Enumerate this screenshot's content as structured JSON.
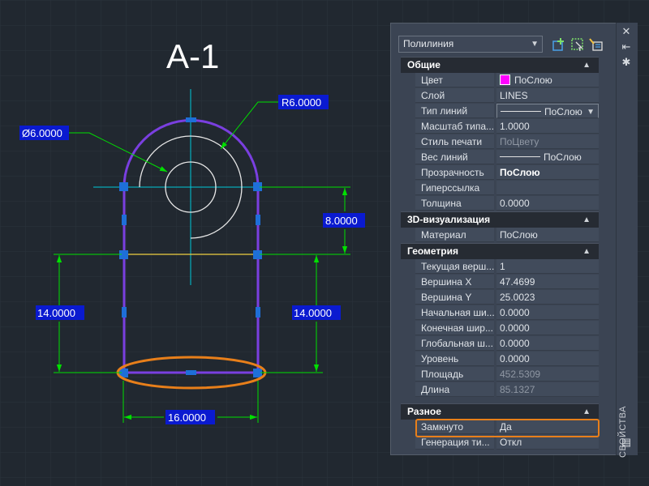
{
  "drawing": {
    "title": "A-1",
    "dims": {
      "radius": "R6.0000",
      "diameter": "Ø6.0000",
      "vertical_small": "8.0000",
      "left_height": "14.0000",
      "right_height": "14.0000",
      "bottom_width": "16.0000"
    },
    "colors": {
      "background": "#212830",
      "grid": "#2b333d",
      "polyline": "#7a3fe0",
      "dimension": "#00e000",
      "centerline": "#00c8d8",
      "circle": "#e8e8e8",
      "horizontal_line": "#f0d040",
      "grip": "#1e6fd8",
      "highlight": "#e87f1a"
    }
  },
  "palette": {
    "object_type": "Полилиния",
    "strip_title": "СВОЙСТВА",
    "categories": {
      "general": "Общие",
      "viz3d": "3D-визуализация",
      "geometry": "Геометрия",
      "misc": "Разное"
    },
    "general": [
      {
        "name": "Цвет",
        "value": "ПоСлою"
      },
      {
        "name": "Слой",
        "value": "LINES"
      },
      {
        "name": "Тип линий",
        "value": "ПоСлою"
      },
      {
        "name": "Масштаб типа...",
        "value": "1.0000"
      },
      {
        "name": "Стиль печати",
        "value": "ПоЦвету"
      },
      {
        "name": "Вес линий",
        "value": "ПоСлою"
      },
      {
        "name": "Прозрачность",
        "value": "ПоСлою"
      },
      {
        "name": "Гиперссылка",
        "value": ""
      },
      {
        "name": "Толщина",
        "value": "0.0000"
      }
    ],
    "viz3d": [
      {
        "name": "Материал",
        "value": "ПоСлою"
      }
    ],
    "geometry": [
      {
        "name": "Текущая верш...",
        "value": "1"
      },
      {
        "name": "Вершина X",
        "value": "47.4699"
      },
      {
        "name": "Вершина Y",
        "value": "25.0023"
      },
      {
        "name": "Начальная ши...",
        "value": "0.0000"
      },
      {
        "name": "Конечная шир...",
        "value": "0.0000"
      },
      {
        "name": "Глобальная ш...",
        "value": "0.0000"
      },
      {
        "name": "Уровень",
        "value": "0.0000"
      },
      {
        "name": "Площадь",
        "value": "452.5309"
      },
      {
        "name": "Длина",
        "value": "85.1327"
      }
    ],
    "misc": [
      {
        "name": "Замкнуто",
        "value": "Да"
      },
      {
        "name": "Генерация ти...",
        "value": "Откл"
      }
    ]
  }
}
